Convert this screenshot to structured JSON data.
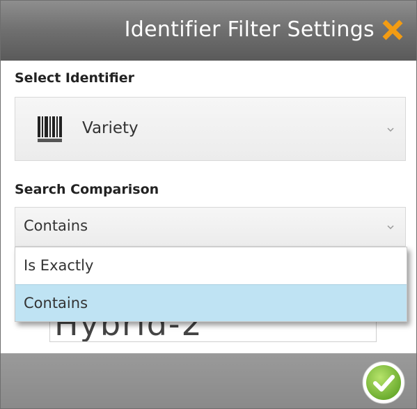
{
  "dialog": {
    "title": "Identifier Filter Settings",
    "close_icon": "close-icon",
    "accent_color": "#f39c12"
  },
  "identifier": {
    "label": "Select Identifier",
    "selected": "Variety",
    "icon": "barcode-icon"
  },
  "comparison": {
    "label": "Search Comparison",
    "selected": "Contains",
    "options": [
      "Is Exactly",
      "Contains"
    ],
    "highlighted": "Contains",
    "highlight_color": "#bfe3f3"
  },
  "search_value": {
    "value": "Hybrid-2"
  },
  "footer": {
    "ok_icon": "check-icon",
    "ok_color": "#7ac143"
  }
}
